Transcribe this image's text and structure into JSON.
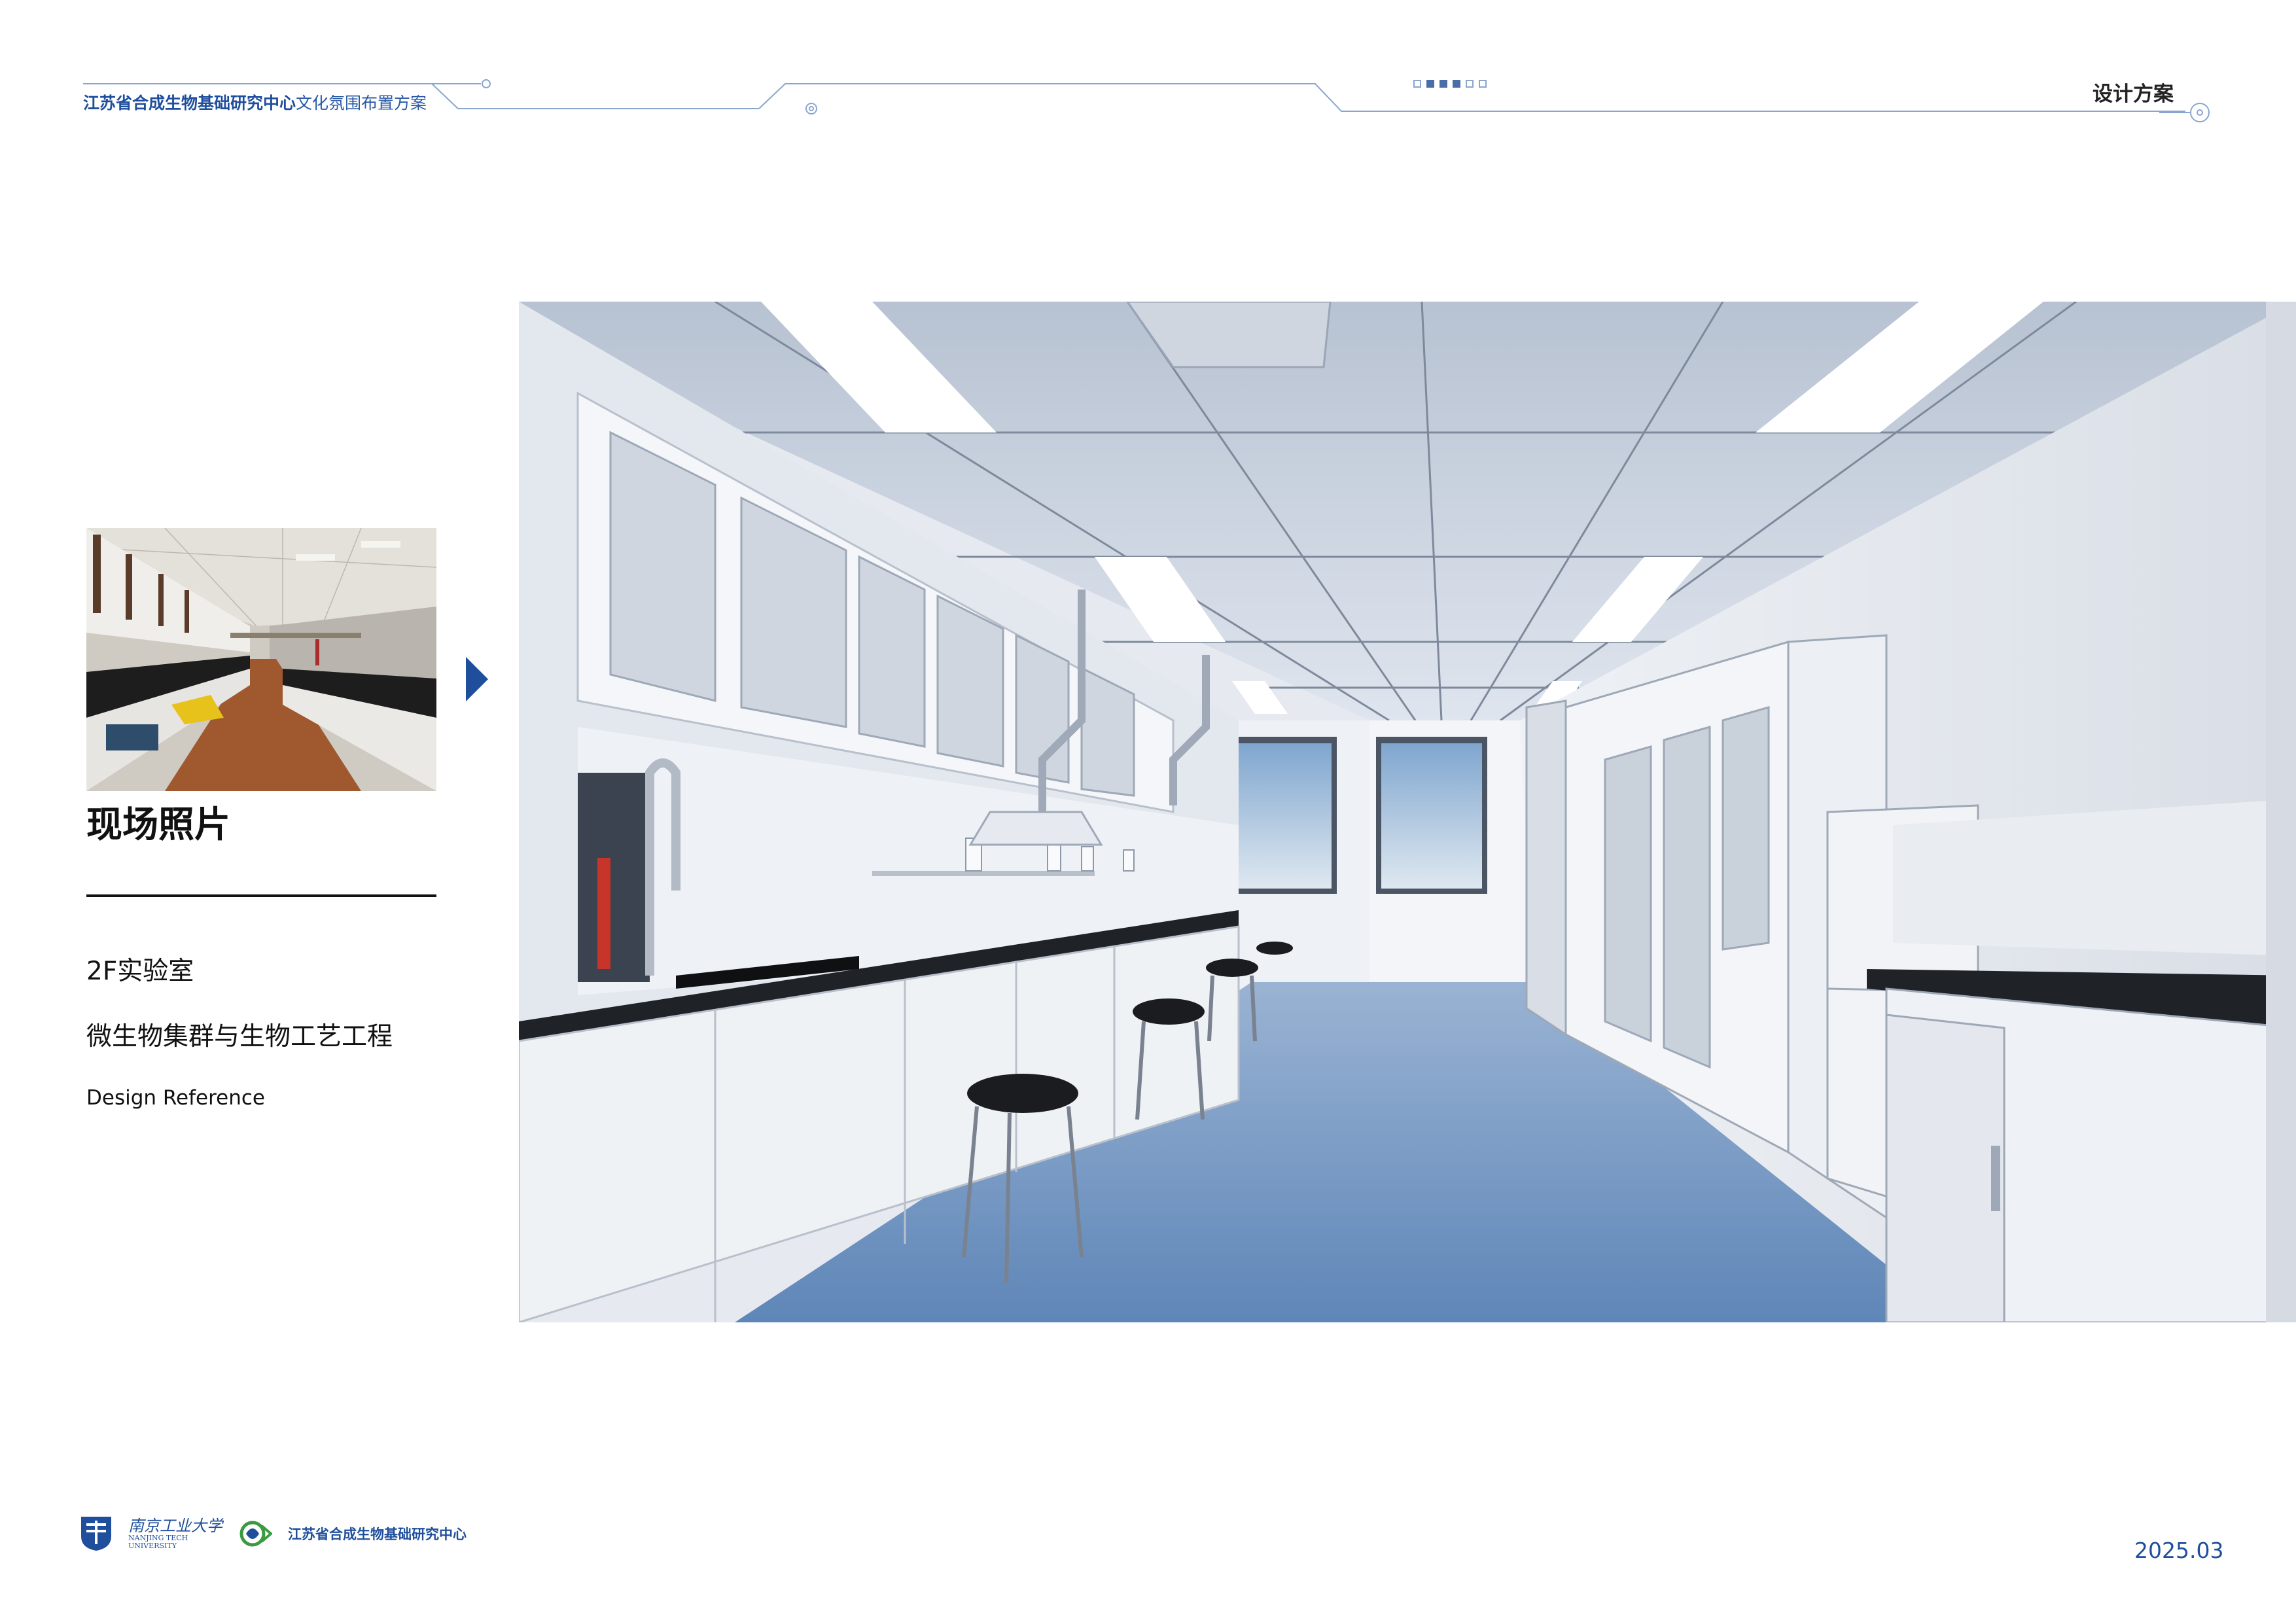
{
  "header": {
    "title_bold": "江苏省合成生物基础研究中心",
    "title_light": "文化氛围布置方案",
    "section": "设计方案",
    "progress_dots": [
      false,
      true,
      true,
      true,
      false,
      false
    ]
  },
  "left": {
    "photo_label": "现场照片",
    "room": "2F实验室",
    "department": "微生物集群与生物工艺工程",
    "reference": "Design Reference"
  },
  "footer": {
    "university_cn": "南京工业大学",
    "university_en_1": "NANJING TECH",
    "university_en_2": "UNIVERSITY",
    "center_name": "江苏省合成生物基础研究中心",
    "date": "2025.03"
  },
  "colors": {
    "brand_blue": "#1f4f9c",
    "line_blue": "#8aa6cf",
    "floor_blue": "#6e93c0"
  },
  "icons": [
    "arrow-right-icon",
    "university-logo",
    "center-logo"
  ]
}
